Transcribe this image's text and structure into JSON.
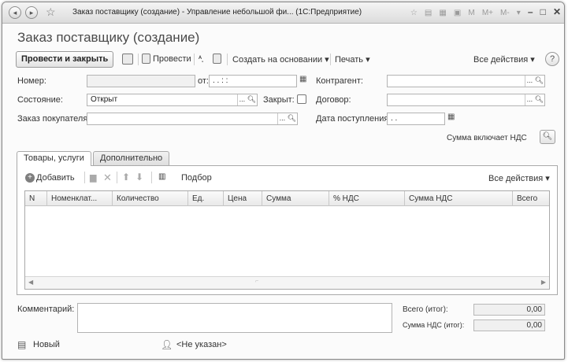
{
  "window": {
    "title": "Заказ поставщику (создание) - Управление небольшой фи... (1С:Предприятие)",
    "icons": {
      "back": "back-icon",
      "forward": "forward-icon",
      "favorite": "star-icon",
      "calc": "calculator-icon",
      "calendar": "calendar-icon"
    },
    "memory_labels": [
      "M",
      "M+",
      "M-"
    ]
  },
  "form": {
    "title": "Заказ поставщику (создание)"
  },
  "toolbar": {
    "post_close": "Провести и закрыть",
    "post": "Провести",
    "create_based": "Создать на основании ▾",
    "print": "Печать ▾",
    "all_actions": "Все действия ▾",
    "help": "?"
  },
  "fields": {
    "number_label": "Номер:",
    "number_value": "",
    "date_label": "от:",
    "date_value": " .  .       :  :",
    "counterparty_label": "Контрагент:",
    "counterparty_value": "",
    "state_label": "Состояние:",
    "state_value": "Открыт",
    "closed_label": "Закрыт:",
    "contract_label": "Договор:",
    "contract_value": "",
    "customer_order_label": "Заказ покупателя:",
    "customer_order_value": "",
    "receipt_date_label": "Дата поступления:",
    "receipt_date_value": " .  .",
    "vat_note": "Сумма включает НДС"
  },
  "tabs": [
    {
      "label": "Товары, услуги",
      "active": true
    },
    {
      "label": "Дополнительно",
      "active": false
    }
  ],
  "grid_toolbar": {
    "add": "Добавить",
    "selection": "Подбор",
    "all_actions": "Все действия ▾"
  },
  "grid": {
    "columns": [
      "N",
      "Номенклат...",
      "Количество",
      "Ед.",
      "Цена",
      "Сумма",
      "% НДС",
      "Сумма НДС",
      "Всего"
    ]
  },
  "bottom": {
    "comment_label": "Комментарий:",
    "comment_value": "",
    "total_label": "Всего (итог):",
    "total_value": "0,00",
    "vat_total_label": "Сумма НДС (итог):",
    "vat_total_value": "0,00",
    "status_new": "Новый",
    "author": "<Не указан>"
  }
}
